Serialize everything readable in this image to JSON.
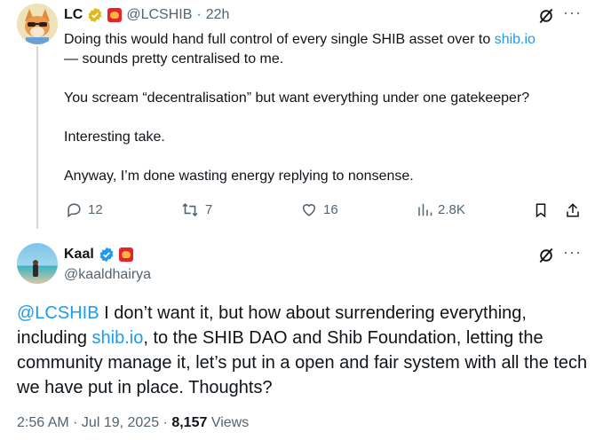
{
  "tweet1": {
    "display_name": "LC",
    "handle": "@LCSHIB",
    "separator": "·",
    "time": "22h",
    "text_lines": [
      [
        "Doing this would hand full control of every single SHIB asset over to ",
        "shib.io"
      ],
      [
        "— sounds pretty centralised to me."
      ],
      [
        "You scream “decentralisation” but want everything under one gatekeeper?"
      ],
      [
        "Interesting take."
      ],
      [
        "Anyway, I’m done wasting energy replying to nonsense."
      ]
    ],
    "replies": "12",
    "reposts": "7",
    "likes": "16",
    "views": "2.8K"
  },
  "tweet2": {
    "display_name": "Kaal",
    "handle": "@kaaldhairya",
    "mention": "@LCSHIB",
    "text_part1": " I don’t want it, but how about surrendering everything,",
    "text_line2_pre": "including ",
    "link": "shib.io",
    "text_line2_post": ", to the SHIB DAO and Shib Foundation, letting the",
    "text_line3": "community manage it, let’s put in a open and fair system with all the tech",
    "text_line4": "we have put in place. Thoughts?",
    "timestamp": "2:56 AM · Jul 19, 2025 · ",
    "views_count": "8,157",
    "views_label": " Views"
  },
  "colors": {
    "link": "#1d9bf0",
    "muted": "#536471",
    "verified_gold": "#e2b719",
    "verified_blue": "#1d9bf0"
  }
}
